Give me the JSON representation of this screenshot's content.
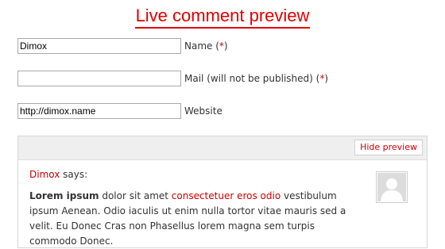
{
  "title": "Live comment preview",
  "form": {
    "name": {
      "value": "Dimox",
      "label": "Name (",
      "req": "*",
      "label_end": ")"
    },
    "mail": {
      "value": "",
      "label": "Mail (will not be published) (",
      "req": "*",
      "label_end": ")"
    },
    "website": {
      "value": "http://dimox.name",
      "label": "Website"
    }
  },
  "preview": {
    "hide_label": "Hide preview",
    "author": "Dimox",
    "says": " says:",
    "text_bold": "Lorem ipsum",
    "text_1": " dolor sit amet ",
    "text_link": "consectetuer eros odio",
    "text_2": " vestibulum ipsum Aenean. Odio iaculis ut enim nulla tortor vitae mauris sed a velit. Eu Donec Cras non Phasellus lorem magna sem turpis commodo Donec."
  },
  "colors": {
    "accent": "#e00000",
    "link": "#cc0000",
    "bar": "#efefef"
  }
}
